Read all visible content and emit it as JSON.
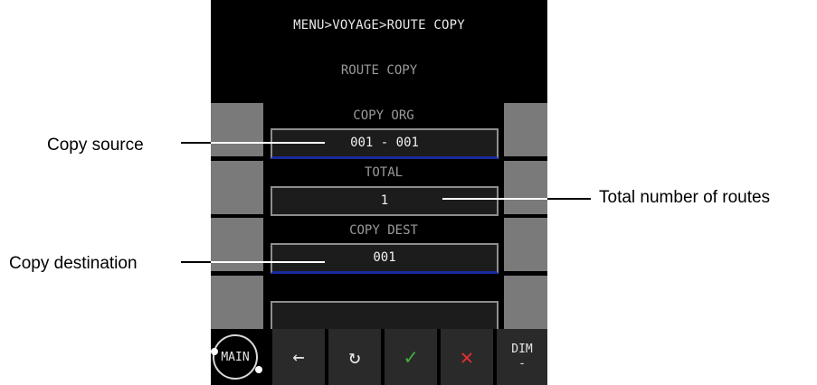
{
  "header": {
    "breadcrumb": "MENU>VOYAGE>ROUTE COPY",
    "title": "ROUTE COPY"
  },
  "fields": {
    "copy_org": {
      "label": "COPY ORG",
      "value": "001 - 001"
    },
    "total": {
      "label": "TOTAL",
      "value": "1"
    },
    "copy_dest": {
      "label": "COPY DEST",
      "value": "001"
    },
    "empty": {
      "value": ""
    }
  },
  "toolbar": {
    "main_label": "MAIN",
    "back_icon": "←",
    "reset_icon": "↻",
    "confirm_icon": "✓",
    "cancel_icon": "✕",
    "dim_label": "DIM",
    "dim_value": "-"
  },
  "callouts": {
    "copy_source": "Copy source",
    "total_routes": "Total number of routes",
    "copy_destination": "Copy destination"
  },
  "colors": {
    "accent_underline": "#1a2aa0",
    "confirm": "#3fae3f",
    "cancel": "#e03030",
    "side_button": "#7a7a7a"
  }
}
